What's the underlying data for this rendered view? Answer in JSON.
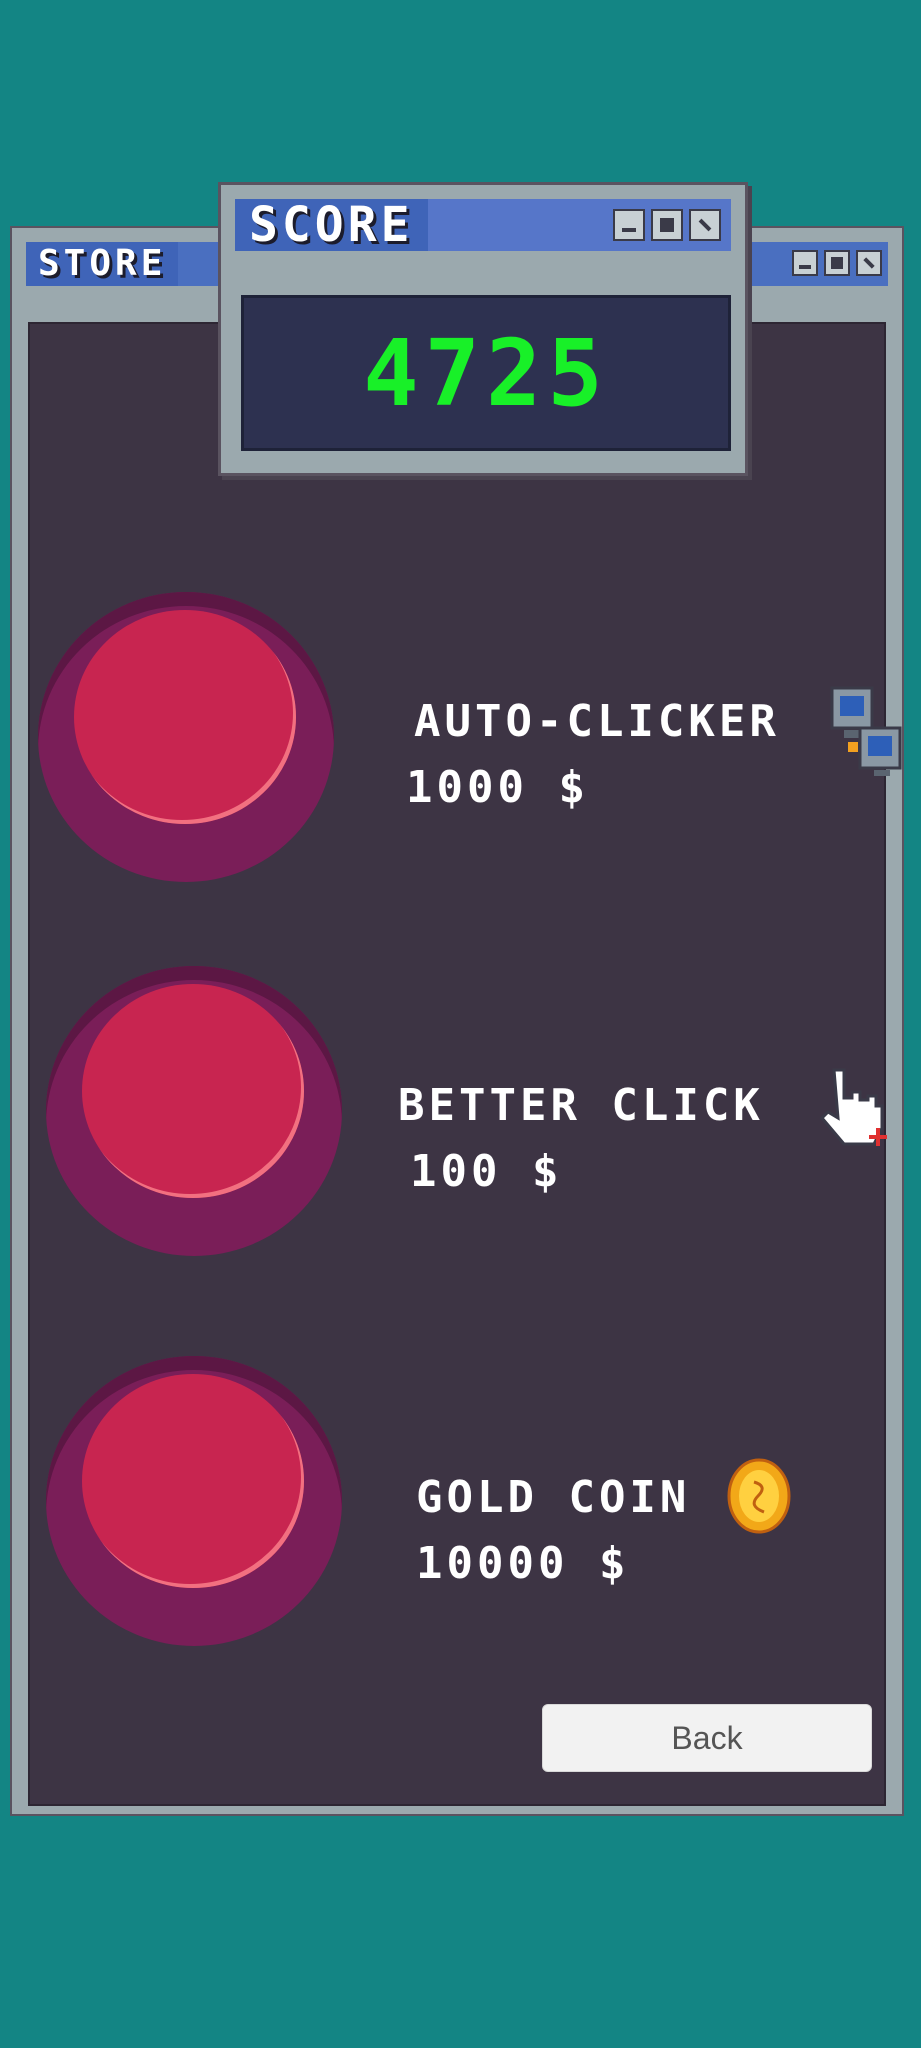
{
  "store": {
    "title": "STORE",
    "items": [
      {
        "name": "AUTO-CLICKER",
        "price": "1000 $",
        "icon": "computers-icon"
      },
      {
        "name": "BETTER CLICK",
        "price": "100 $",
        "icon": "pointer-hand-icon"
      },
      {
        "name": "GOLD COIN",
        "price": "10000 $",
        "icon": "gold-coin-icon"
      }
    ],
    "back_label": "Back"
  },
  "score": {
    "title": "SCORE",
    "value": "4725"
  },
  "colors": {
    "background": "#138584",
    "panel": "#3d3444",
    "button_red": "#c82550",
    "score_green": "#18f028"
  }
}
